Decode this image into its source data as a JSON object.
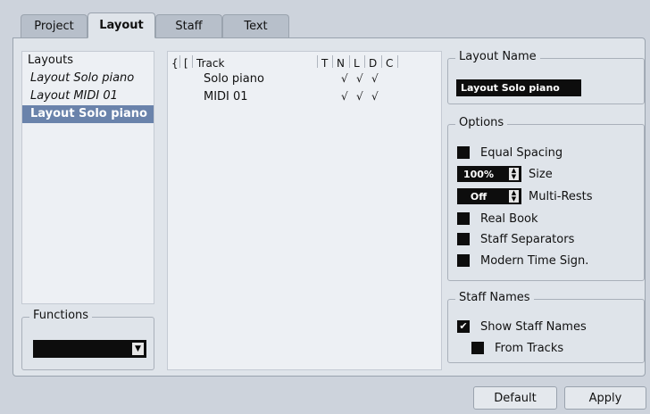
{
  "tabs": [
    {
      "label": "Project"
    },
    {
      "label": "Layout"
    },
    {
      "label": "Staff"
    },
    {
      "label": "Text"
    }
  ],
  "layouts": {
    "header": "Layouts",
    "items": [
      "Layout Solo piano",
      "Layout MIDI 01",
      "Layout Solo piano"
    ]
  },
  "functions": {
    "label": "Functions",
    "value": ""
  },
  "tracks": {
    "headers": {
      "brace": "{",
      "bracket": "[",
      "track": "Track",
      "t": "T",
      "n": "N",
      "l": "L",
      "d": "D",
      "c": "C"
    },
    "rows": [
      {
        "name": "Solo piano",
        "n": "√",
        "l": "√",
        "d": "√"
      },
      {
        "name": "MIDI 01",
        "n": "√",
        "l": "√",
        "d": "√"
      }
    ]
  },
  "layout_name": {
    "label": "Layout Name",
    "value": "Layout Solo piano"
  },
  "options": {
    "label": "Options",
    "equal_spacing": "Equal Spacing",
    "size_value": "100%",
    "size_label": "Size",
    "multirests_value": "Off",
    "multirests_label": "Multi-Rests",
    "real_book": "Real Book",
    "staff_separators": "Staff Separators",
    "modern_time": "Modern Time Sign."
  },
  "staff_names": {
    "label": "Staff Names",
    "show": "Show Staff Names",
    "show_checked": true,
    "from_tracks": "From Tracks"
  },
  "buttons": {
    "default": "Default",
    "apply": "Apply"
  }
}
